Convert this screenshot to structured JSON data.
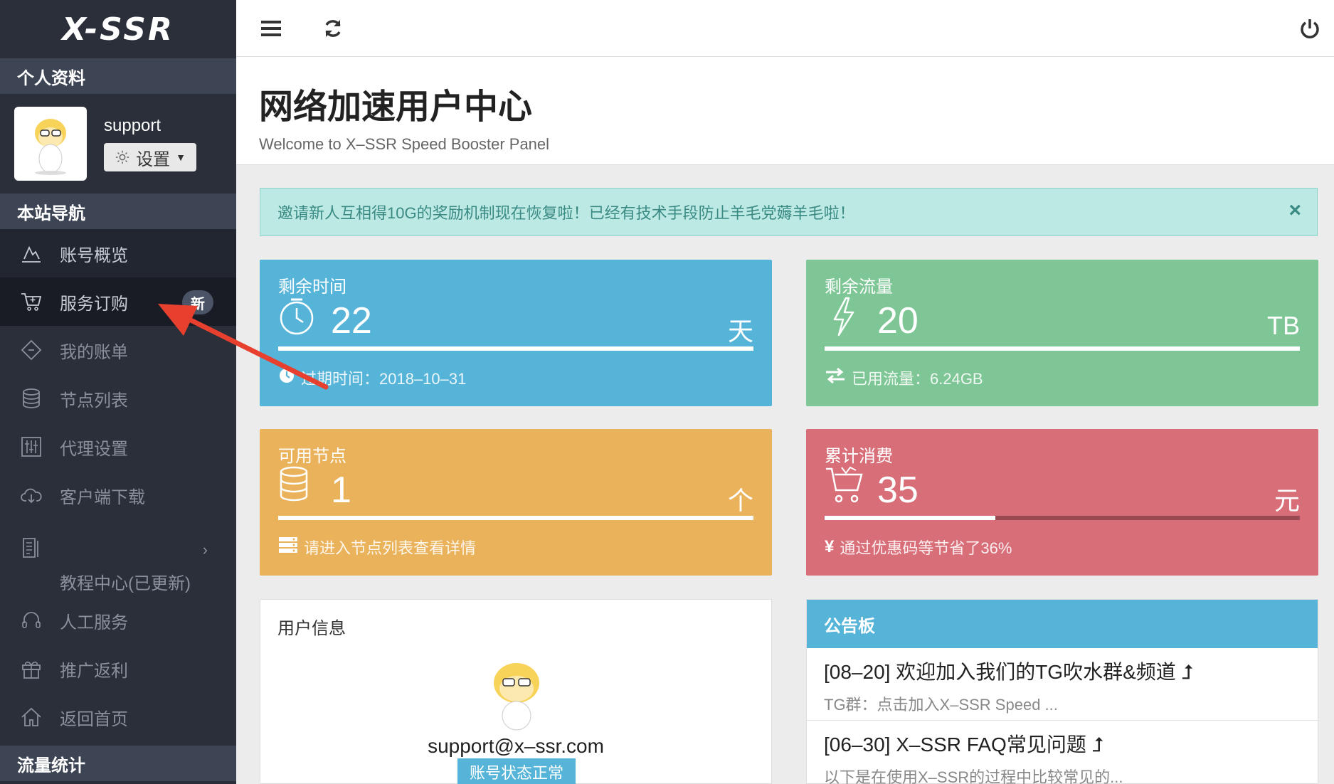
{
  "sidebar": {
    "logo": "X-SSR",
    "section_profile": "个人资料",
    "username": "support",
    "settings_label": "设置",
    "section_nav": "本站导航",
    "badge_new": "新",
    "items": [
      {
        "label": "账号概览",
        "icon": "chart-icon"
      },
      {
        "label": "服务订购",
        "icon": "cart-icon"
      },
      {
        "label": "我的账单",
        "icon": "ticket-icon"
      },
      {
        "label": "节点列表",
        "icon": "database-icon"
      },
      {
        "label": "代理设置",
        "icon": "sliders-icon"
      },
      {
        "label": "客户端下载",
        "icon": "cloud-download-icon"
      },
      {
        "label": "教程中心(已更新)",
        "icon": "document-icon"
      },
      {
        "label": "人工服务",
        "icon": "headset-icon"
      },
      {
        "label": "推广返利",
        "icon": "gift-icon"
      },
      {
        "label": "返回首页",
        "icon": "home-icon"
      }
    ],
    "section_stats": "流量统计"
  },
  "header": {
    "title": "网络加速用户中心",
    "subtitle": "Welcome to X–SSR Speed Booster Panel"
  },
  "alert": {
    "text": "邀请新人互相得10G的奖励机制现在恢复啦！已经有技术手段防止羊毛党薅羊毛啦！",
    "close": "×"
  },
  "cards": {
    "time": {
      "title": "剩余时间",
      "value": "22",
      "unit": "天",
      "footer": "过期时间：2018–10–31",
      "progress": 1.0
    },
    "traffic": {
      "title": "剩余流量",
      "value": "20",
      "unit": "TB",
      "footer": "已用流量：6.24GB",
      "progress": 1.0
    },
    "nodes": {
      "title": "可用节点",
      "value": "1",
      "unit": "个",
      "footer": "请进入节点列表查看详情",
      "progress": 1.0
    },
    "spend": {
      "title": "累计消费",
      "value": "35",
      "unit": "元",
      "footer": "通过优惠码等节省了36%",
      "footer_symbol": "¥",
      "progress": 0.36
    }
  },
  "user_panel": {
    "title": "用户信息",
    "email": "support@x–ssr.com",
    "status": "账号状态正常"
  },
  "notice_panel": {
    "title": "公告板",
    "items": [
      {
        "title": "[08–20] 欢迎加入我们的TG吹水群&频道 ⮥",
        "desc": "TG群：点击加入X–SSR Speed ..."
      },
      {
        "title": "[06–30] X–SSR FAQ常见问题 ⮥",
        "desc": "以下是在使用X–SSR的过程中比较常见的..."
      }
    ]
  },
  "colors": {
    "sidebar_bg": "#2b2f3a",
    "time_card": "#56b4d8",
    "traffic_card": "#7ec695",
    "nodes_card": "#eab25a",
    "spend_card": "#d86e78",
    "annotation_arrow": "#e8402f"
  }
}
